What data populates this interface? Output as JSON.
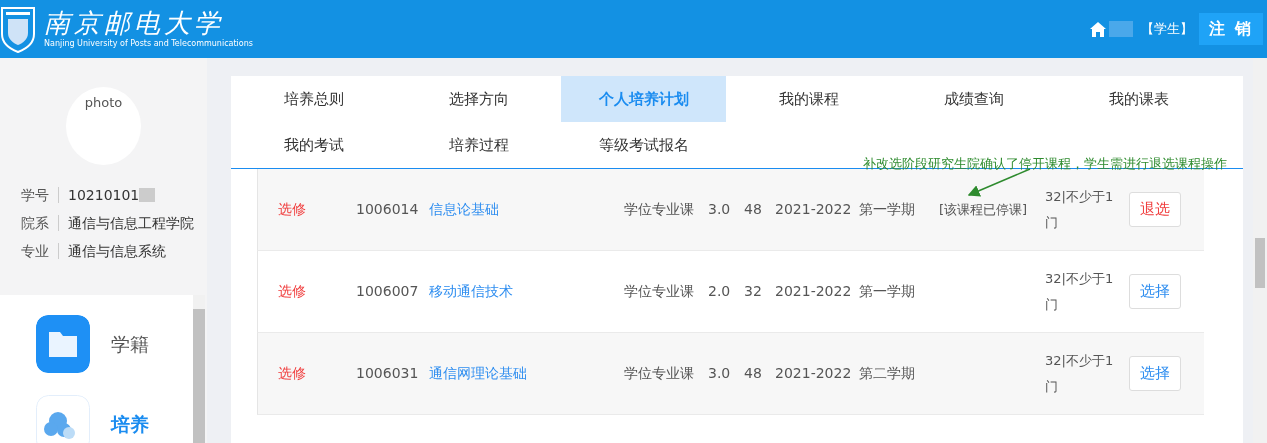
{
  "header": {
    "logo_title": "南京邮电大学",
    "logo_subtitle": "Nanjing University of Posts and Telecommunications",
    "role": "【学生】",
    "logout": "注 销"
  },
  "profile": {
    "photo_alt": "photo",
    "fields": [
      {
        "label": "学号",
        "value": "10210101",
        "redacted": true
      },
      {
        "label": "院系",
        "value": "通信与信息工程学院",
        "redacted": false
      },
      {
        "label": "专业",
        "value": "通信与信息系统",
        "redacted": false
      }
    ]
  },
  "side_menu": [
    {
      "label": "学籍",
      "kind": "folder",
      "selected": false
    },
    {
      "label": "培养",
      "kind": "cloud",
      "selected": true
    }
  ],
  "tabs": [
    {
      "label": "培养总则",
      "selected": false
    },
    {
      "label": "选择方向",
      "selected": false
    },
    {
      "label": "个人培养计划",
      "selected": true
    },
    {
      "label": "我的课程",
      "selected": false
    },
    {
      "label": "成绩查询",
      "selected": false
    },
    {
      "label": "我的课表",
      "selected": false
    },
    {
      "label": "我的考试",
      "selected": false
    },
    {
      "label": "培养过程",
      "selected": false
    },
    {
      "label": "等级考试报名",
      "selected": false
    }
  ],
  "annotation": "补改选阶段研究生院确认了停开课程，学生需进行退选课程操作",
  "courses": [
    {
      "type": "选修",
      "code": "1006014",
      "name": "信息论基础",
      "category": "学位专业课",
      "credits": "3.0",
      "hours": "48",
      "year": "2021-2022",
      "term": "第一学期",
      "note": "[该课程已停课]",
      "requirement": "32|不少于1门",
      "action": {
        "label": "退选",
        "kind": "drop"
      }
    },
    {
      "type": "选修",
      "code": "1006007",
      "name": "移动通信技术",
      "category": "学位专业课",
      "credits": "2.0",
      "hours": "32",
      "year": "2021-2022",
      "term": "第一学期",
      "requirement": "32|不少于1门",
      "action": {
        "label": "选择",
        "kind": "select"
      }
    },
    {
      "type": "选修",
      "code": "1006031",
      "name": "通信网理论基础",
      "category": "学位专业课",
      "credits": "3.0",
      "hours": "48",
      "year": "2021-2022",
      "term": "第二学期",
      "requirement": "32|不少于1门",
      "action": {
        "label": "选择",
        "kind": "select"
      }
    }
  ]
}
